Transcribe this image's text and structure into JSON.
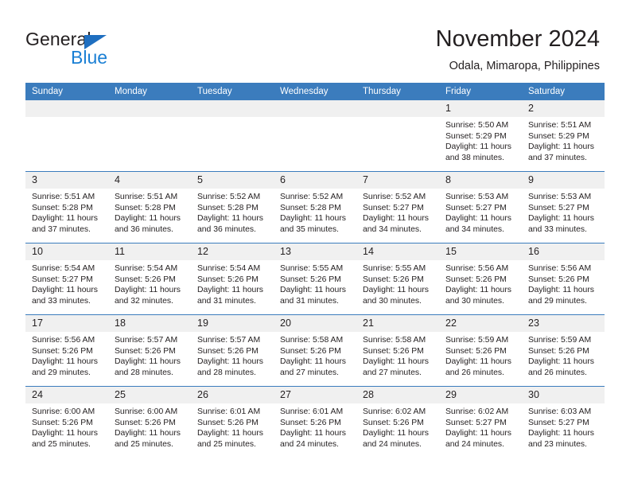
{
  "brand": {
    "name_part1": "General",
    "name_part2": "Blue",
    "triangle_color": "#1f6fc0",
    "blue_color": "#1a7fd4"
  },
  "header": {
    "title": "November 2024",
    "subtitle": "Odala, Mimaropa, Philippines"
  },
  "theme": {
    "header_bar_color": "#3b7cbd",
    "day_band_color": "#f0f0f0",
    "text_color": "#231f20"
  },
  "calendar": {
    "weekdays": [
      "Sunday",
      "Monday",
      "Tuesday",
      "Wednesday",
      "Thursday",
      "Friday",
      "Saturday"
    ],
    "weeks": [
      [
        {
          "day": "",
          "lines": []
        },
        {
          "day": "",
          "lines": []
        },
        {
          "day": "",
          "lines": []
        },
        {
          "day": "",
          "lines": []
        },
        {
          "day": "",
          "lines": []
        },
        {
          "day": "1",
          "lines": [
            "Sunrise: 5:50 AM",
            "Sunset: 5:29 PM",
            "Daylight: 11 hours",
            "and 38 minutes."
          ]
        },
        {
          "day": "2",
          "lines": [
            "Sunrise: 5:51 AM",
            "Sunset: 5:29 PM",
            "Daylight: 11 hours",
            "and 37 minutes."
          ]
        }
      ],
      [
        {
          "day": "3",
          "lines": [
            "Sunrise: 5:51 AM",
            "Sunset: 5:28 PM",
            "Daylight: 11 hours",
            "and 37 minutes."
          ]
        },
        {
          "day": "4",
          "lines": [
            "Sunrise: 5:51 AM",
            "Sunset: 5:28 PM",
            "Daylight: 11 hours",
            "and 36 minutes."
          ]
        },
        {
          "day": "5",
          "lines": [
            "Sunrise: 5:52 AM",
            "Sunset: 5:28 PM",
            "Daylight: 11 hours",
            "and 36 minutes."
          ]
        },
        {
          "day": "6",
          "lines": [
            "Sunrise: 5:52 AM",
            "Sunset: 5:28 PM",
            "Daylight: 11 hours",
            "and 35 minutes."
          ]
        },
        {
          "day": "7",
          "lines": [
            "Sunrise: 5:52 AM",
            "Sunset: 5:27 PM",
            "Daylight: 11 hours",
            "and 34 minutes."
          ]
        },
        {
          "day": "8",
          "lines": [
            "Sunrise: 5:53 AM",
            "Sunset: 5:27 PM",
            "Daylight: 11 hours",
            "and 34 minutes."
          ]
        },
        {
          "day": "9",
          "lines": [
            "Sunrise: 5:53 AM",
            "Sunset: 5:27 PM",
            "Daylight: 11 hours",
            "and 33 minutes."
          ]
        }
      ],
      [
        {
          "day": "10",
          "lines": [
            "Sunrise: 5:54 AM",
            "Sunset: 5:27 PM",
            "Daylight: 11 hours",
            "and 33 minutes."
          ]
        },
        {
          "day": "11",
          "lines": [
            "Sunrise: 5:54 AM",
            "Sunset: 5:26 PM",
            "Daylight: 11 hours",
            "and 32 minutes."
          ]
        },
        {
          "day": "12",
          "lines": [
            "Sunrise: 5:54 AM",
            "Sunset: 5:26 PM",
            "Daylight: 11 hours",
            "and 31 minutes."
          ]
        },
        {
          "day": "13",
          "lines": [
            "Sunrise: 5:55 AM",
            "Sunset: 5:26 PM",
            "Daylight: 11 hours",
            "and 31 minutes."
          ]
        },
        {
          "day": "14",
          "lines": [
            "Sunrise: 5:55 AM",
            "Sunset: 5:26 PM",
            "Daylight: 11 hours",
            "and 30 minutes."
          ]
        },
        {
          "day": "15",
          "lines": [
            "Sunrise: 5:56 AM",
            "Sunset: 5:26 PM",
            "Daylight: 11 hours",
            "and 30 minutes."
          ]
        },
        {
          "day": "16",
          "lines": [
            "Sunrise: 5:56 AM",
            "Sunset: 5:26 PM",
            "Daylight: 11 hours",
            "and 29 minutes."
          ]
        }
      ],
      [
        {
          "day": "17",
          "lines": [
            "Sunrise: 5:56 AM",
            "Sunset: 5:26 PM",
            "Daylight: 11 hours",
            "and 29 minutes."
          ]
        },
        {
          "day": "18",
          "lines": [
            "Sunrise: 5:57 AM",
            "Sunset: 5:26 PM",
            "Daylight: 11 hours",
            "and 28 minutes."
          ]
        },
        {
          "day": "19",
          "lines": [
            "Sunrise: 5:57 AM",
            "Sunset: 5:26 PM",
            "Daylight: 11 hours",
            "and 28 minutes."
          ]
        },
        {
          "day": "20",
          "lines": [
            "Sunrise: 5:58 AM",
            "Sunset: 5:26 PM",
            "Daylight: 11 hours",
            "and 27 minutes."
          ]
        },
        {
          "day": "21",
          "lines": [
            "Sunrise: 5:58 AM",
            "Sunset: 5:26 PM",
            "Daylight: 11 hours",
            "and 27 minutes."
          ]
        },
        {
          "day": "22",
          "lines": [
            "Sunrise: 5:59 AM",
            "Sunset: 5:26 PM",
            "Daylight: 11 hours",
            "and 26 minutes."
          ]
        },
        {
          "day": "23",
          "lines": [
            "Sunrise: 5:59 AM",
            "Sunset: 5:26 PM",
            "Daylight: 11 hours",
            "and 26 minutes."
          ]
        }
      ],
      [
        {
          "day": "24",
          "lines": [
            "Sunrise: 6:00 AM",
            "Sunset: 5:26 PM",
            "Daylight: 11 hours",
            "and 25 minutes."
          ]
        },
        {
          "day": "25",
          "lines": [
            "Sunrise: 6:00 AM",
            "Sunset: 5:26 PM",
            "Daylight: 11 hours",
            "and 25 minutes."
          ]
        },
        {
          "day": "26",
          "lines": [
            "Sunrise: 6:01 AM",
            "Sunset: 5:26 PM",
            "Daylight: 11 hours",
            "and 25 minutes."
          ]
        },
        {
          "day": "27",
          "lines": [
            "Sunrise: 6:01 AM",
            "Sunset: 5:26 PM",
            "Daylight: 11 hours",
            "and 24 minutes."
          ]
        },
        {
          "day": "28",
          "lines": [
            "Sunrise: 6:02 AM",
            "Sunset: 5:26 PM",
            "Daylight: 11 hours",
            "and 24 minutes."
          ]
        },
        {
          "day": "29",
          "lines": [
            "Sunrise: 6:02 AM",
            "Sunset: 5:27 PM",
            "Daylight: 11 hours",
            "and 24 minutes."
          ]
        },
        {
          "day": "30",
          "lines": [
            "Sunrise: 6:03 AM",
            "Sunset: 5:27 PM",
            "Daylight: 11 hours",
            "and 23 minutes."
          ]
        }
      ]
    ]
  }
}
